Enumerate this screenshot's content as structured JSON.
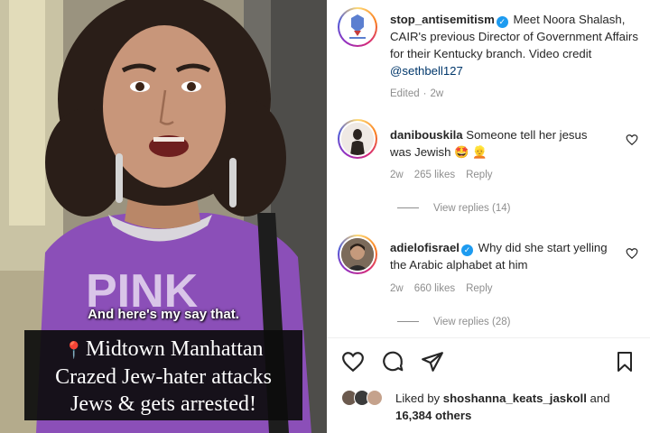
{
  "media": {
    "spoken_subtitle": "And here's my say that.",
    "caption_lines": [
      "Midtown Manhattan",
      "Crazed Jew-hater attacks",
      "Jews & gets arrested!"
    ],
    "pin_icon": "location-pin-icon",
    "shirt_text": "PINK"
  },
  "post": {
    "username": "stop_antisemitism",
    "verified": true,
    "caption": "Meet Noora Shalash, CAIR's previous Director of Government Affairs for their Kentucky branch. Video credit",
    "mention": "@sethbell127",
    "edited": "Edited",
    "age": "2w"
  },
  "comments": [
    {
      "username": "danibouskila",
      "verified": false,
      "text": "Someone tell her jesus was Jewish 🤩 👱",
      "age": "2w",
      "likes": "265 likes",
      "reply_label": "Reply",
      "view_replies": "View replies (14)"
    },
    {
      "username": "adielofisrael",
      "verified": true,
      "text": "Why did she start yelling the Arabic alphabet at him",
      "age": "2w",
      "likes": "660 likes",
      "reply_label": "Reply",
      "view_replies": "View replies (28)"
    }
  ],
  "actions": {
    "icons": [
      "heart-icon",
      "comment-icon",
      "share-icon",
      "bookmark-icon"
    ]
  },
  "likes_summary": {
    "prefix": "Liked by",
    "user": "shoshanna_keats_jaskoll",
    "and": "and",
    "others": "16,384 others"
  },
  "colors": {
    "verified_blue": "#1d9bf0",
    "meta_gray": "#8e8e8e",
    "link_blue": "#00376b",
    "shirt_purple": "#8b4fb8"
  }
}
